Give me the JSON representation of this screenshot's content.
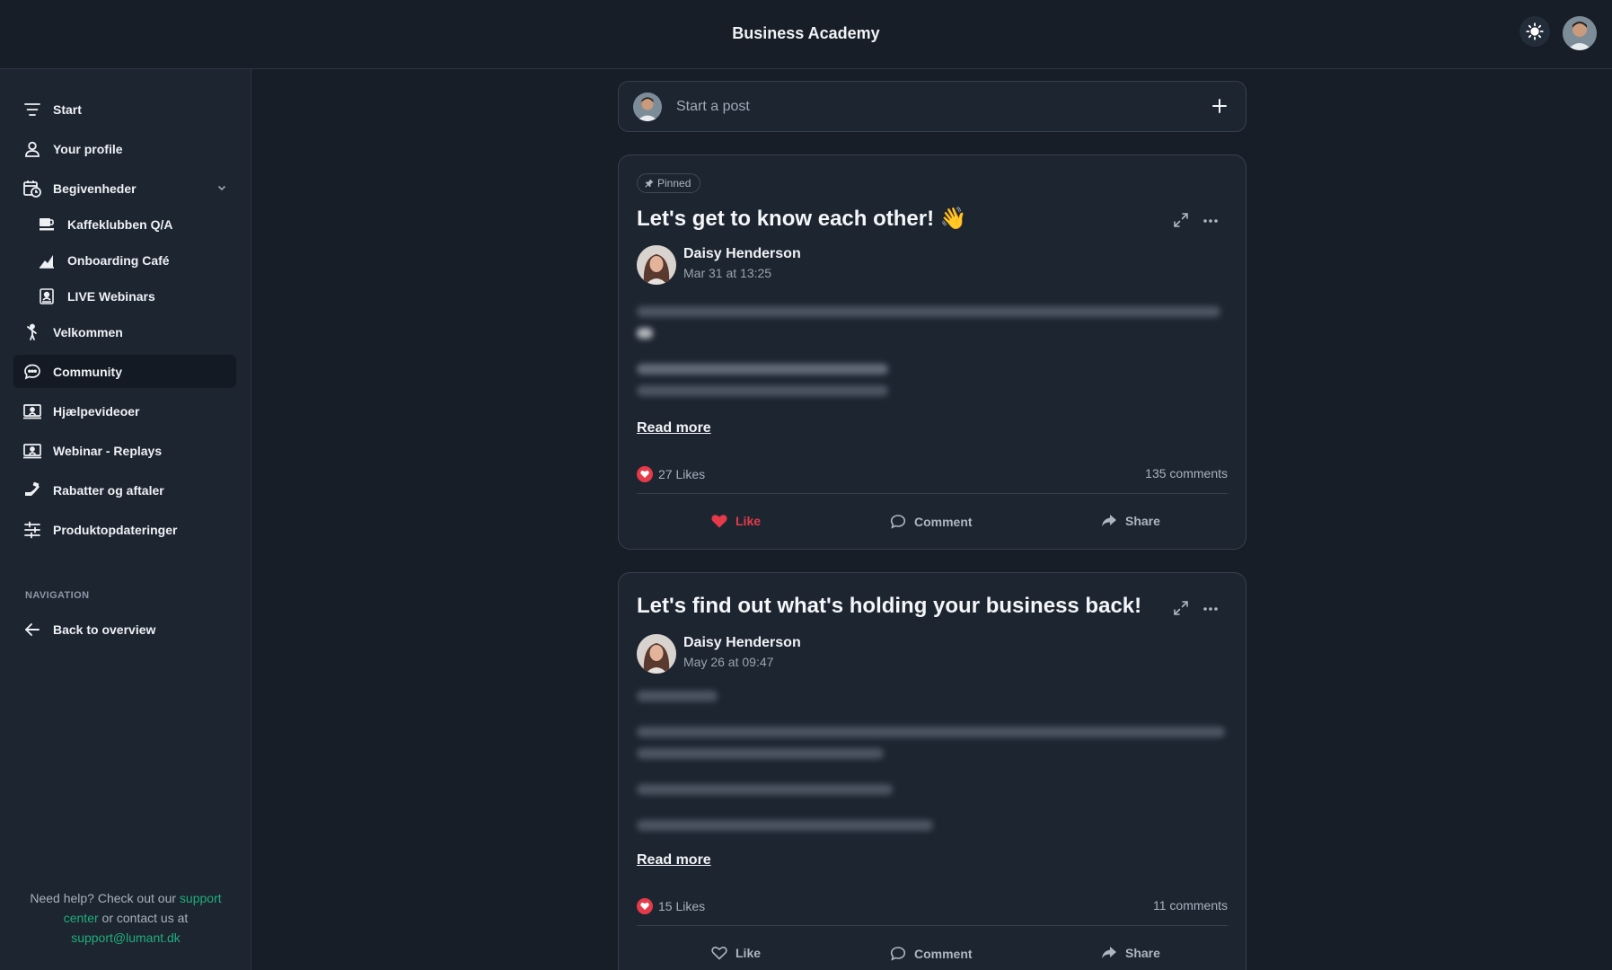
{
  "header": {
    "title": "Business Academy",
    "theme_icon": "sun-icon"
  },
  "sidebar": {
    "items": [
      {
        "label": "Start",
        "icon": "menu-lines-icon"
      },
      {
        "label": "Your profile",
        "icon": "user-icon"
      },
      {
        "label": "Begivenheder",
        "icon": "calendar-clock-icon"
      },
      {
        "label": "Kaffeklubben Q/A",
        "icon": "coffee-icon"
      },
      {
        "label": "Onboarding Café",
        "icon": "chart-icon"
      },
      {
        "label": "LIVE Webinars",
        "icon": "presentation-icon"
      },
      {
        "label": "Velkommen",
        "icon": "waving-person-icon"
      },
      {
        "label": "Community",
        "icon": "chat-icon"
      },
      {
        "label": "Hjælpevideoer",
        "icon": "screen-user-icon"
      },
      {
        "label": "Webinar - Replays",
        "icon": "screen-user-icon"
      },
      {
        "label": "Rabatter og aftaler",
        "icon": "discount-icon"
      },
      {
        "label": "Produktopdateringer",
        "icon": "sliders-icon"
      }
    ],
    "navigation_title": "NAVIGATION",
    "back_label": "Back to overview",
    "help": {
      "prefix": "Need help? Check out our ",
      "link1a": "support",
      "link1b": "center",
      "middle": " or contact us at",
      "email": "support@lumant.dk"
    }
  },
  "composer": {
    "placeholder": "Start a post"
  },
  "posts": [
    {
      "pinned_label": "Pinned",
      "title": "Let's get to know each other! 👋",
      "author": "Daisy Henderson",
      "date": "Mar 31 at 13:25",
      "read_more": "Read more",
      "likes": "27 Likes",
      "comments": "135 comments",
      "like_label": "Like",
      "comment_label": "Comment",
      "share_label": "Share",
      "liked": true
    },
    {
      "title": "Let's find out what's holding your business back!",
      "author": "Daisy Henderson",
      "date": "May 26 at 09:47",
      "read_more": "Read more",
      "likes": "15 Likes",
      "comments": "11 comments",
      "like_label": "Like",
      "comment_label": "Comment",
      "share_label": "Share",
      "liked": false
    }
  ],
  "colors": {
    "background": "#171e28",
    "panel": "#1d2531",
    "accent_like": "#e53a4a",
    "link_green": "#1fae78"
  }
}
